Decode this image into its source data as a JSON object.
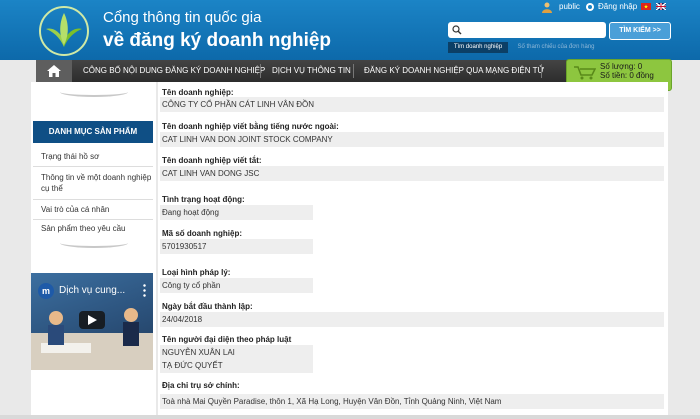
{
  "header": {
    "title_line1": "Cổng thông tin quốc gia",
    "title_line2": "về đăng ký doanh nghiệp",
    "user": "public",
    "login": "Đăng nhập"
  },
  "search": {
    "placeholder": "",
    "button": "TÌM KIẾM >>",
    "tabs": [
      "Tìm doanh nghiệp",
      "Số tham chiếu của đơn hàng"
    ]
  },
  "nav": {
    "items": [
      "CÔNG BỐ NỘI DUNG ĐĂNG KÝ DOANH NGHIỆP",
      "DỊCH VỤ THÔNG TIN",
      "ĐĂNG KÝ DOANH NGHIỆP QUA MẠNG ĐIỆN TỬ"
    ]
  },
  "cart": {
    "quantity": "Số lượng: 0",
    "amount": "Số tiền: 0 đồng"
  },
  "sidebar": {
    "header": "DANH MỤC SẢN PHẨM",
    "items": [
      "Trạng thái hồ sơ",
      "Thông tin về một doanh nghiệp cụ thể",
      "Vai trò của cá nhân",
      "Sản phẩm theo yêu cầu"
    ],
    "video_title": "Dịch vụ cung..."
  },
  "company": {
    "name_label": "Tên doanh nghiệp:",
    "name": "CÔNG TY CỔ PHẦN CÁT LINH VÂN ĐỒN",
    "foreign_label": "Tên doanh nghiệp viết bằng tiếng nước ngoài:",
    "foreign": "CAT LINH VAN DON JOINT STOCK COMPANY",
    "short_label": "Tên doanh nghiệp viết tắt:",
    "short": "CAT LINH VAN DONG JSC",
    "status_label": "Tình trạng hoạt động:",
    "status": "Đang hoạt động",
    "code_label": "Mã số doanh nghiệp:",
    "code": "5701930517",
    "type_label": "Loại hình pháp lý:",
    "type": "Công ty cổ phần",
    "date_label": "Ngày bắt đầu thành lập:",
    "date": "24/04/2018",
    "rep_label": "Tên người đại diện theo pháp luật",
    "rep1": "NGUYỄN XUÂN LAI",
    "rep2": "TẠ ĐỨC QUYẾT",
    "addr_label": "Địa chỉ trụ sở chính:",
    "addr": "Toà nhà Mai Quyền Paradise, thôn 1, Xã Hạ Long, Huyện Vân Đồn, Tỉnh Quảng Ninh, Việt Nam"
  },
  "colors": {
    "header_blue": "#1b84c6",
    "nav_dark": "#333333",
    "sidebar_header": "#0f4f85",
    "cart_green": "#8dc63f"
  }
}
